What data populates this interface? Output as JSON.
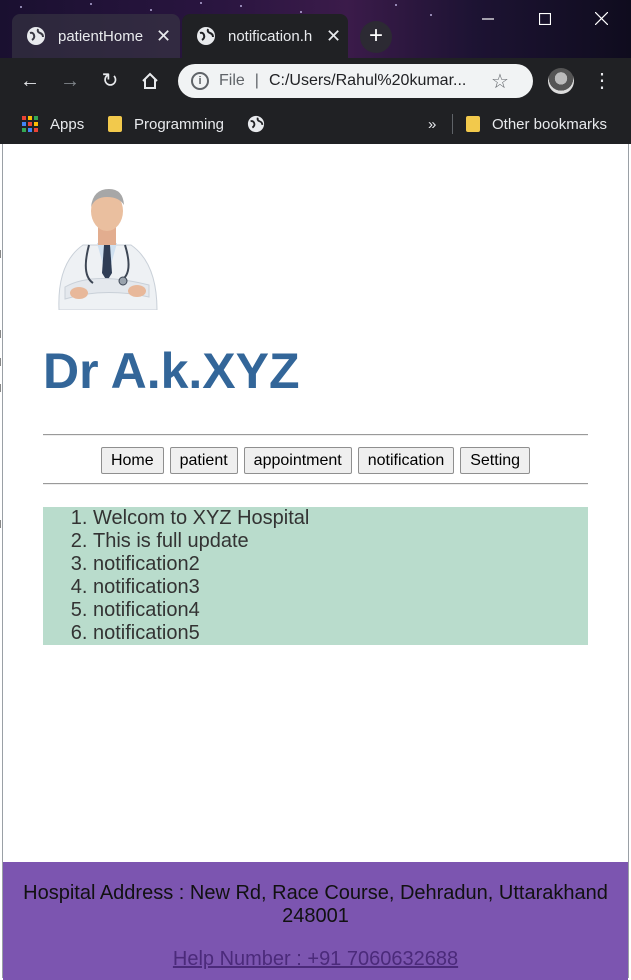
{
  "browser": {
    "tabs": [
      {
        "title": "patientHome",
        "active": false
      },
      {
        "title": "notification.h",
        "active": true
      }
    ],
    "address": {
      "scheme_label": "File",
      "url": "C:/Users/Rahul%20kumar..."
    },
    "bookmarks": {
      "apps_label": "Apps",
      "programming_label": "Programming",
      "overflow_label": "»",
      "other_label": "Other bookmarks"
    }
  },
  "page": {
    "doctor_name": "Dr A.k.XYZ",
    "menu": [
      "Home",
      "patient",
      "appointment",
      "notification",
      "Setting"
    ],
    "notifications": [
      "Welcom to XYZ Hospital",
      "This is full update",
      "notification2",
      "notification3",
      "notification4",
      "notification5"
    ],
    "footer": {
      "address": "Hospital Address : New Rd, Race Course, Dehradun, Uttarakhand 248001",
      "help": "Help Number : +91 7060632688"
    }
  },
  "colors": {
    "heading": "#336699",
    "notification_bg": "#b9dccc",
    "footer_bg": "#7c55b0",
    "chrome_dark": "#202124"
  }
}
